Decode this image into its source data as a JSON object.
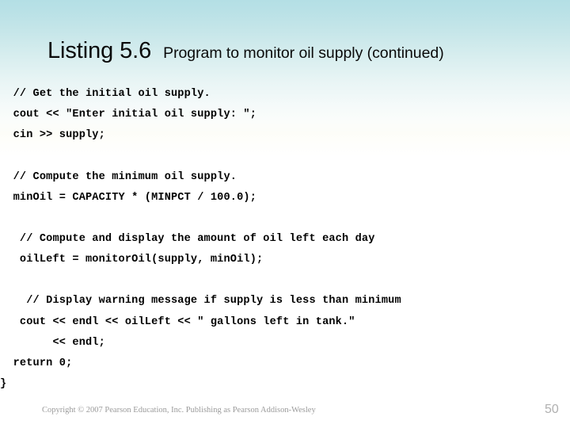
{
  "slide": {
    "title_main": "Listing 5.6",
    "title_sub": "Program to monitor oil supply (continued)",
    "background_top_color": "#b4dfe5",
    "background_bottom_color": "#ffffff"
  },
  "code": {
    "language": "cpp",
    "blocks": [
      {
        "lines": [
          "  // Get the initial oil supply.",
          "  cout << \"Enter initial oil supply: \";",
          "  cin >> supply;"
        ]
      },
      {
        "lines": [
          "  // Compute the minimum oil supply.",
          "  minOil = CAPACITY * (MINPCT / 100.0);"
        ]
      },
      {
        "lines": [
          "   // Compute and display the amount of oil left each day",
          "   oilLeft = monitorOil(supply, minOil);"
        ]
      },
      {
        "lines": [
          "    // Display warning message if supply is less than minimum",
          "   cout << endl << oilLeft << \" gallons left in tank.\"",
          "        << endl;",
          "  return 0;",
          "}"
        ]
      }
    ]
  },
  "footer": {
    "copyright": "Copyright © 2007 Pearson Education, Inc. Publishing as Pearson Addison-Wesley",
    "page_number": "50"
  }
}
